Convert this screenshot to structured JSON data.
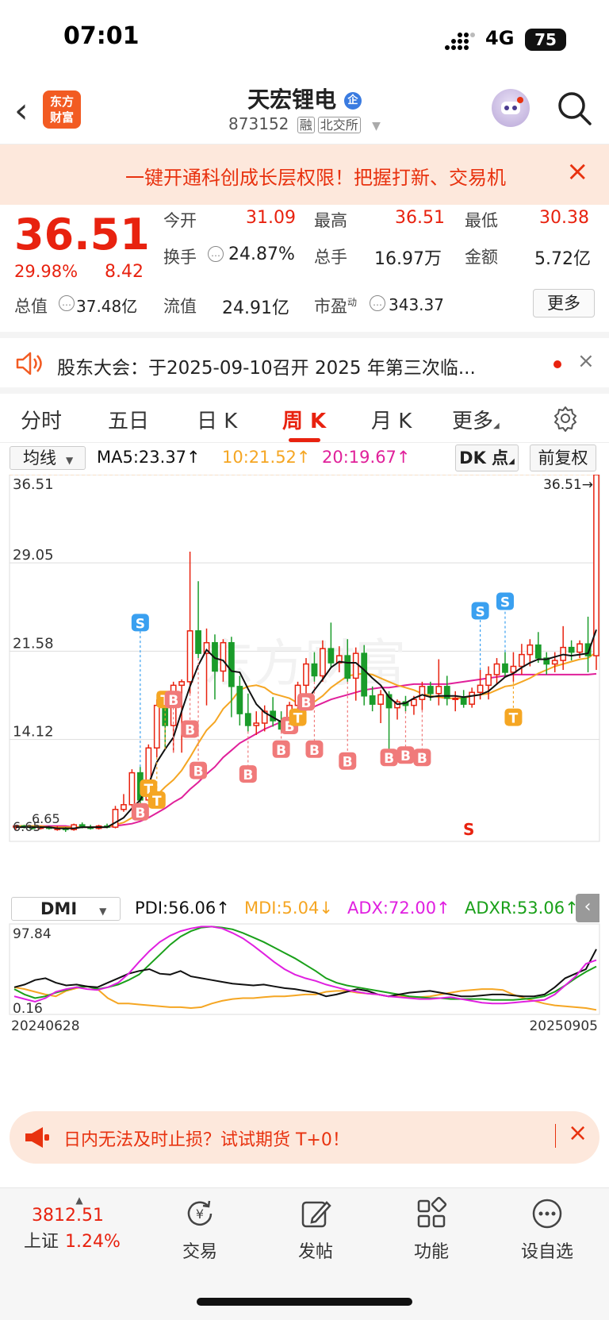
{
  "status_bar": {
    "time": "07:01",
    "network": "4G",
    "battery": "75"
  },
  "header": {
    "logo_line1": "东方",
    "logo_line2": "财富",
    "title": "天宏锂电",
    "code": "873152",
    "tag_margin": "融",
    "tag_exchange": "北交所"
  },
  "promo": {
    "text": "一键开通科创成长层权限！把握打新、交易机"
  },
  "quote": {
    "price": "36.51",
    "change_pct": "29.98%",
    "change_amt": "8.42",
    "fields": [
      {
        "label": "今开",
        "value": "31.09"
      },
      {
        "label": "最高",
        "value": "36.51"
      },
      {
        "label": "最低",
        "value": "30.38"
      },
      {
        "label": "换手",
        "value": "24.87%"
      },
      {
        "label": "总手",
        "value": "16.97万"
      },
      {
        "label": "金额",
        "value": "5.72亿"
      },
      {
        "label": "总值",
        "value": "37.48亿"
      },
      {
        "label": "流值",
        "value": "24.91亿"
      },
      {
        "label": "市盈",
        "sup": "动",
        "value": "343.37"
      }
    ],
    "more_label": "更多"
  },
  "notice": {
    "text": "股东大会：于2025-09-10召开 2025 年第三次临..."
  },
  "tabs": [
    "分时",
    "五日",
    "日 K",
    "周 K",
    "月 K",
    "更多"
  ],
  "active_tab": "周 K",
  "ma": {
    "selector": "均线",
    "ma5": "MA5:23.37",
    "ma10": "10:21.52",
    "ma20": "20:19.67",
    "dk_label": "DK 点",
    "fq_label": "前复权",
    "colors": {
      "ma5": "#111111",
      "ma10": "#f5a623",
      "ma20": "#e0209a"
    }
  },
  "chart_data": {
    "type": "candlestick",
    "y_ticks": [
      "36.51",
      "29.05",
      "21.58",
      "14.12"
    ],
    "ylim": [
      5.5,
      36.51
    ],
    "last_price_label": "36.51→",
    "low_labels": [
      "6.65",
      "6.65"
    ],
    "signal_label": "S",
    "x_labels": [
      "20240628",
      "20250905"
    ],
    "candles": [
      [
        6.7,
        6.9,
        6.5,
        6.8
      ],
      [
        6.8,
        6.9,
        6.6,
        6.7
      ],
      [
        6.7,
        6.8,
        6.5,
        6.6
      ],
      [
        6.6,
        6.8,
        6.5,
        6.7
      ],
      [
        6.7,
        6.8,
        6.5,
        6.6
      ],
      [
        6.6,
        6.8,
        6.4,
        6.6
      ],
      [
        6.6,
        6.7,
        6.3,
        6.5
      ],
      [
        6.5,
        7.0,
        6.4,
        6.9
      ],
      [
        6.9,
        7.1,
        6.6,
        6.7
      ],
      [
        6.7,
        6.9,
        6.5,
        6.6
      ],
      [
        6.6,
        6.9,
        6.5,
        6.8
      ],
      [
        6.8,
        7.0,
        6.6,
        6.7
      ],
      [
        6.7,
        8.5,
        6.6,
        8.2
      ],
      [
        8.2,
        9.5,
        8.0,
        8.6
      ],
      [
        8.6,
        11.6,
        8.4,
        11.3
      ],
      [
        11.3,
        11.8,
        8.6,
        9.0
      ],
      [
        9.0,
        13.7,
        8.8,
        13.4
      ],
      [
        13.4,
        17.5,
        12.6,
        17.0
      ],
      [
        17.0,
        17.5,
        13.3,
        15.3
      ],
      [
        15.3,
        19.0,
        13.0,
        18.7
      ],
      [
        18.7,
        19.2,
        13.0,
        19.0
      ],
      [
        19.0,
        30.0,
        18.0,
        23.3
      ],
      [
        23.3,
        27.5,
        21.0,
        21.4
      ],
      [
        21.4,
        23.5,
        17.0,
        22.3
      ],
      [
        22.3,
        23.0,
        17.5,
        19.9
      ],
      [
        19.9,
        22.6,
        19.0,
        22.3
      ],
      [
        22.3,
        22.8,
        16.0,
        18.6
      ],
      [
        18.6,
        19.5,
        15.3,
        16.3
      ],
      [
        16.3,
        18.0,
        14.8,
        15.3
      ],
      [
        15.3,
        16.5,
        14.5,
        15.5
      ],
      [
        15.5,
        17.0,
        14.8,
        16.5
      ],
      [
        16.5,
        17.7,
        15.2,
        15.7
      ],
      [
        15.7,
        16.5,
        14.8,
        15.0
      ],
      [
        15.0,
        17.3,
        14.9,
        17.0
      ],
      [
        17.0,
        19.0,
        15.8,
        18.7
      ],
      [
        18.7,
        21.0,
        17.8,
        20.5
      ],
      [
        20.5,
        21.5,
        19.0,
        19.5
      ],
      [
        19.5,
        22.5,
        19.0,
        21.8
      ],
      [
        21.8,
        24.0,
        20.2,
        20.6
      ],
      [
        20.6,
        22.0,
        19.8,
        21.2
      ],
      [
        21.2,
        22.6,
        19.0,
        19.3
      ],
      [
        19.3,
        21.9,
        17.4,
        21.4
      ],
      [
        21.4,
        22.1,
        17.0,
        17.8
      ],
      [
        17.8,
        18.6,
        16.5,
        17.1
      ],
      [
        17.1,
        18.3,
        15.5,
        17.9
      ],
      [
        17.9,
        18.2,
        13.3,
        16.8
      ],
      [
        16.8,
        17.5,
        15.8,
        17.3
      ],
      [
        17.3,
        17.8,
        16.5,
        17.0
      ],
      [
        17.0,
        17.8,
        16.2,
        17.5
      ],
      [
        17.5,
        19.0,
        16.6,
        18.6
      ],
      [
        18.6,
        19.0,
        17.4,
        18.0
      ],
      [
        18.0,
        20.9,
        17.0,
        18.6
      ],
      [
        18.6,
        19.5,
        17.0,
        17.6
      ],
      [
        17.6,
        18.2,
        16.5,
        17.6
      ],
      [
        17.6,
        18.3,
        16.8,
        17.1
      ],
      [
        17.1,
        18.5,
        16.8,
        18.1
      ],
      [
        18.1,
        20.0,
        17.5,
        18.7
      ],
      [
        18.7,
        20.3,
        17.5,
        19.6
      ],
      [
        19.6,
        21.0,
        18.8,
        20.5
      ],
      [
        20.5,
        21.5,
        19.4,
        19.8
      ],
      [
        19.8,
        21.5,
        19.0,
        20.3
      ],
      [
        20.3,
        22.2,
        19.6,
        21.3
      ],
      [
        21.3,
        22.6,
        20.3,
        22.1
      ],
      [
        22.1,
        23.2,
        20.6,
        21.0
      ],
      [
        21.0,
        21.5,
        19.6,
        20.5
      ],
      [
        20.5,
        21.5,
        19.8,
        20.8
      ],
      [
        20.8,
        23.7,
        20.0,
        21.9
      ],
      [
        21.9,
        22.5,
        20.8,
        21.5
      ],
      [
        21.5,
        22.5,
        21.0,
        22.2
      ],
      [
        22.2,
        24.5,
        19.8,
        21.2
      ],
      [
        21.2,
        36.51,
        20.0,
        36.51
      ]
    ],
    "ma5": [
      6.7,
      6.7,
      6.7,
      6.7,
      6.7,
      6.6,
      6.6,
      6.6,
      6.7,
      6.7,
      6.7,
      6.7,
      7.1,
      7.5,
      8.3,
      9.0,
      10.3,
      12.2,
      13.3,
      14.3,
      16.5,
      18.6,
      20.4,
      21.7,
      21.0,
      20.8,
      19.9,
      19.8,
      18.4,
      17.1,
      16.4,
      16.0,
      15.6,
      15.9,
      16.6,
      17.3,
      18.3,
      19.2,
      20.2,
      20.7,
      20.6,
      20.6,
      20.0,
      19.3,
      18.7,
      17.7,
      17.1,
      17.2,
      17.6,
      17.9,
      17.7,
      17.8,
      17.8,
      17.8,
      17.7,
      17.8,
      17.9,
      18.2,
      18.8,
      19.4,
      19.7,
      20.2,
      20.6,
      20.9,
      20.9,
      21.1,
      21.3,
      21.2,
      21.3,
      21.4,
      23.4
    ],
    "ma10": [
      6.8,
      6.8,
      6.8,
      6.8,
      6.7,
      6.7,
      6.7,
      6.7,
      6.7,
      6.7,
      6.7,
      6.7,
      6.9,
      7.1,
      7.5,
      7.9,
      8.5,
      9.4,
      10.1,
      10.7,
      11.5,
      12.6,
      13.8,
      14.9,
      15.6,
      16.7,
      17.4,
      18.3,
      18.6,
      18.7,
      18.5,
      18.0,
      17.8,
      17.6,
      17.2,
      16.9,
      17.3,
      17.8,
      18.5,
      19.0,
      19.5,
      19.6,
      19.7,
      19.6,
      19.3,
      19.0,
      18.7,
      18.5,
      18.3,
      18.0,
      17.8,
      17.7,
      17.6,
      17.6,
      17.6,
      17.8,
      17.9,
      18.0,
      18.3,
      18.6,
      18.7,
      19.0,
      19.3,
      19.7,
      20.0,
      20.3,
      20.5,
      20.7,
      20.9,
      21.0,
      21.5
    ],
    "ma20": [
      6.8,
      6.8,
      6.8,
      6.8,
      6.8,
      6.8,
      6.8,
      6.7,
      6.7,
      6.7,
      6.7,
      6.7,
      6.8,
      6.9,
      7.0,
      7.2,
      7.5,
      7.9,
      8.3,
      8.8,
      9.2,
      9.9,
      10.5,
      11.2,
      11.8,
      12.6,
      13.2,
      13.8,
      14.2,
      14.6,
      15.0,
      15.3,
      15.6,
      15.9,
      16.2,
      16.6,
      16.9,
      17.2,
      17.5,
      17.7,
      17.9,
      18.1,
      18.3,
      18.4,
      18.5,
      18.5,
      18.6,
      18.7,
      18.8,
      18.8,
      18.8,
      18.8,
      18.8,
      18.9,
      19.0,
      19.1,
      19.2,
      19.3,
      19.4,
      19.5,
      19.6,
      19.6,
      19.6,
      19.6,
      19.6,
      19.6,
      19.6,
      19.6,
      19.6,
      19.6,
      19.67
    ],
    "markers": [
      {
        "i": 15,
        "label": "S",
        "pos": "top",
        "price": 24.0
      },
      {
        "i": 15,
        "label": "B",
        "pos": "bottom",
        "price": 8.0
      },
      {
        "i": 16,
        "label": "T",
        "pos": "bottom",
        "price": 10.0
      },
      {
        "i": 17,
        "label": "T",
        "pos": "bottom",
        "price": 9.0
      },
      {
        "i": 18,
        "label": "T",
        "pos": "bottom",
        "price": 17.5
      },
      {
        "i": 19,
        "label": "B",
        "pos": "bottom",
        "price": 17.5
      },
      {
        "i": 21,
        "label": "B",
        "pos": "bottom",
        "price": 15.0
      },
      {
        "i": 22,
        "label": "B",
        "pos": "bottom",
        "price": 11.5
      },
      {
        "i": 28,
        "label": "B",
        "pos": "bottom",
        "price": 11.2
      },
      {
        "i": 32,
        "label": "B",
        "pos": "bottom",
        "price": 13.3
      },
      {
        "i": 33,
        "label": "B",
        "pos": "bottom",
        "price": 15.3
      },
      {
        "i": 34,
        "label": "T",
        "pos": "bottom",
        "price": 16.0
      },
      {
        "i": 35,
        "label": "B",
        "pos": "bottom",
        "price": 17.3
      },
      {
        "i": 36,
        "label": "B",
        "pos": "bottom",
        "price": 13.3
      },
      {
        "i": 40,
        "label": "B",
        "pos": "bottom",
        "price": 12.3
      },
      {
        "i": 45,
        "label": "B",
        "pos": "bottom",
        "price": 12.6
      },
      {
        "i": 47,
        "label": "B",
        "pos": "bottom",
        "price": 12.8
      },
      {
        "i": 49,
        "label": "B",
        "pos": "bottom",
        "price": 12.6
      },
      {
        "i": 56,
        "label": "S",
        "pos": "top",
        "price": 25.0
      },
      {
        "i": 59,
        "label": "S",
        "pos": "top",
        "price": 25.8
      },
      {
        "i": 60,
        "label": "T",
        "pos": "bottom",
        "price": 16.0
      }
    ],
    "watermark": "东方财富"
  },
  "dmi": {
    "selector": "DMI",
    "pdi": "PDI:56.06",
    "mdi": "MDI:5.04",
    "adx": "ADX:72.00",
    "adxr": "ADXR:53.06",
    "y_top": "97.84",
    "y_bottom": "0.16",
    "colors": {
      "pdi": "#e020e0",
      "mdi": "#f5a623",
      "adx": "#111111",
      "adxr": "#1aa01a"
    },
    "pdi_values": [
      20,
      17,
      14,
      18,
      25,
      28,
      30,
      28,
      27,
      30,
      35,
      45,
      58,
      70,
      80,
      87,
      92,
      95,
      97,
      97,
      95,
      90,
      84,
      76,
      67,
      58,
      50,
      44,
      40,
      37,
      33,
      30,
      27,
      25,
      23,
      22,
      20,
      19,
      18,
      17,
      17,
      18,
      19,
      17,
      15,
      13,
      12,
      12,
      13,
      14,
      15,
      16,
      22,
      32,
      42,
      56,
      60
    ],
    "mdi_values": [
      30,
      28,
      25,
      22,
      20,
      26,
      29,
      31,
      28,
      18,
      12,
      12,
      11,
      10,
      9,
      8,
      8,
      7,
      8,
      12,
      15,
      17,
      18,
      18,
      19,
      20,
      20,
      21,
      22,
      22,
      25,
      26,
      26,
      24,
      23,
      22,
      20,
      20,
      19,
      19,
      20,
      22,
      24,
      26,
      27,
      28,
      28,
      27,
      22,
      18,
      15,
      12,
      10,
      9,
      8,
      7,
      5
    ],
    "adx_values": [
      30,
      33,
      38,
      40,
      35,
      32,
      33,
      31,
      30,
      35,
      40,
      45,
      48,
      50,
      45,
      44,
      48,
      42,
      40,
      38,
      36,
      34,
      33,
      32,
      33,
      31,
      29,
      28,
      26,
      24,
      20,
      22,
      25,
      28,
      26,
      22,
      20,
      22,
      24,
      25,
      26,
      24,
      22,
      20,
      20,
      21,
      22,
      22,
      21,
      20,
      20,
      22,
      30,
      40,
      45,
      50,
      72
    ],
    "adxr_values": [
      28,
      22,
      18,
      20,
      24,
      27,
      30,
      31,
      28,
      30,
      33,
      38,
      44,
      55,
      66,
      77,
      86,
      92,
      96,
      97,
      96,
      94,
      90,
      85,
      80,
      74,
      68,
      62,
      55,
      48,
      40,
      35,
      32,
      30,
      28,
      26,
      24,
      22,
      20,
      19,
      18,
      18,
      17,
      17,
      17,
      17,
      16,
      16,
      16,
      17,
      18,
      20,
      25,
      32,
      40,
      47,
      53
    ],
    "x_start": "20240628",
    "x_end": "20250905"
  },
  "bottom_ad": {
    "text": "日内无法及时止损？试试期货 T+0！"
  },
  "nav": {
    "index_value": "3812.51",
    "index_name": "上证",
    "index_change": "1.24%",
    "items": [
      {
        "label": "交易",
        "icon": "trade-icon"
      },
      {
        "label": "发帖",
        "icon": "post-icon"
      },
      {
        "label": "功能",
        "icon": "function-icon"
      },
      {
        "label": "设自选",
        "icon": "more-dots-icon"
      }
    ]
  }
}
